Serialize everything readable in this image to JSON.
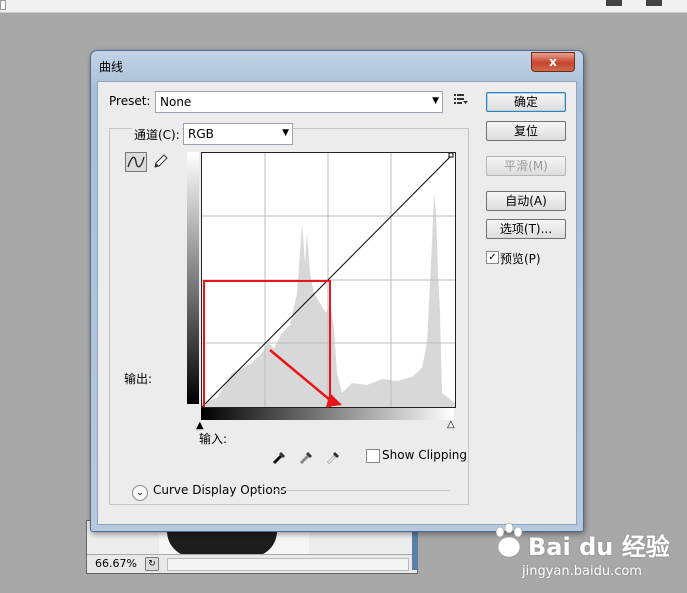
{
  "dialog": {
    "title": "曲线",
    "close_label": "x"
  },
  "preset": {
    "label": "Preset:",
    "value": "None"
  },
  "channel": {
    "label": "通道(C):",
    "value": "RGB"
  },
  "graph": {
    "output_label": "输出:",
    "input_label": "输入:"
  },
  "show_clipping_label": "Show Clipping",
  "curve_display_options_label": "Curve Display Options",
  "buttons": {
    "ok": "确定",
    "reset": "复位",
    "smooth": "平滑(M)",
    "auto": "自动(A)",
    "options": "选项(T)..."
  },
  "preview": {
    "label": "预览(P)",
    "checked": true
  },
  "document": {
    "zoom": "66.67%"
  },
  "watermark": {
    "logo": "Bai du 经验",
    "url": "jingyan.baidu.com"
  },
  "icons": [
    "curve-tool-icon",
    "pencil-tool-icon",
    "preset-menu-icon",
    "black-point-eyedropper-icon",
    "gray-point-eyedropper-icon",
    "white-point-eyedropper-icon",
    "chevron-down-icon",
    "close-icon"
  ],
  "colors": {
    "annotation": "#e8161b",
    "titlebar": "#a9bfd7",
    "dialog_bg": "#ececec"
  }
}
